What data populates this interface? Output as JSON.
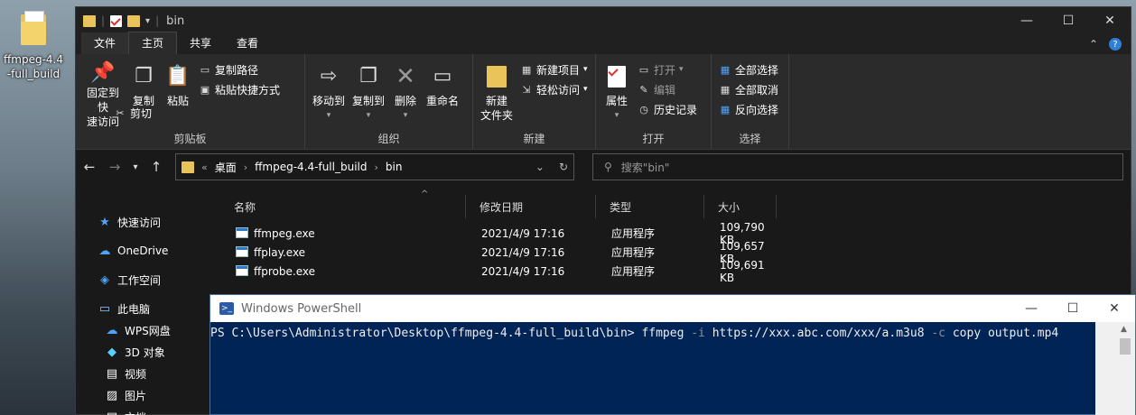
{
  "desktop": {
    "icon_label": "ffmpeg-4.4-full_build"
  },
  "explorer": {
    "title": "bin",
    "menu_tabs": [
      "文件",
      "主页",
      "共享",
      "查看"
    ],
    "ribbon": {
      "clipboard": {
        "label": "剪贴板",
        "pin": "固定到快\n速访问",
        "copy": "复制",
        "paste": "粘贴",
        "copy_path": "复制路径",
        "paste_shortcut": "粘贴快捷方式",
        "cut": "剪切"
      },
      "organize": {
        "label": "组织",
        "move_to": "移动到",
        "copy_to": "复制到",
        "delete": "删除",
        "rename": "重命名"
      },
      "new": {
        "label": "新建",
        "new_folder": "新建\n文件夹",
        "new_item": "新建项目",
        "easy_access": "轻松访问"
      },
      "open": {
        "label": "打开",
        "properties": "属性",
        "open": "打开",
        "edit": "编辑",
        "history": "历史记录"
      },
      "select": {
        "label": "选择",
        "select_all": "全部选择",
        "select_none": "全部取消",
        "invert": "反向选择"
      }
    },
    "address": {
      "overflow": "«",
      "segments": [
        "桌面",
        "ffmpeg-4.4-full_build",
        "bin"
      ]
    },
    "search_placeholder": "搜索\"bin\"",
    "nav": {
      "quick_access": "快速访问",
      "onedrive": "OneDrive",
      "workspace": "工作空间",
      "this_pc": "此电脑",
      "wps": "WPS网盘",
      "objects3d": "3D 对象",
      "videos": "视频",
      "pictures": "图片",
      "docs": "文档"
    },
    "columns": [
      "名称",
      "修改日期",
      "类型",
      "大小"
    ],
    "files": [
      {
        "name": "ffmpeg.exe",
        "date": "2021/4/9 17:16",
        "type": "应用程序",
        "size": "109,790 KB"
      },
      {
        "name": "ffplay.exe",
        "date": "2021/4/9 17:16",
        "type": "应用程序",
        "size": "109,657 KB"
      },
      {
        "name": "ffprobe.exe",
        "date": "2021/4/9 17:16",
        "type": "应用程序",
        "size": "109,691 KB"
      }
    ]
  },
  "powershell": {
    "title": "Windows PowerShell",
    "prompt": "PS C:\\Users\\Administrator\\Desktop\\ffmpeg-4.4-full_build\\bin> ",
    "cmd": "ffmpeg",
    "flag_i": "-i",
    "url": "https://xxx.abc.com/xxx/a.m3u8",
    "flag_c": "-c",
    "rest": "copy output.mp4"
  }
}
